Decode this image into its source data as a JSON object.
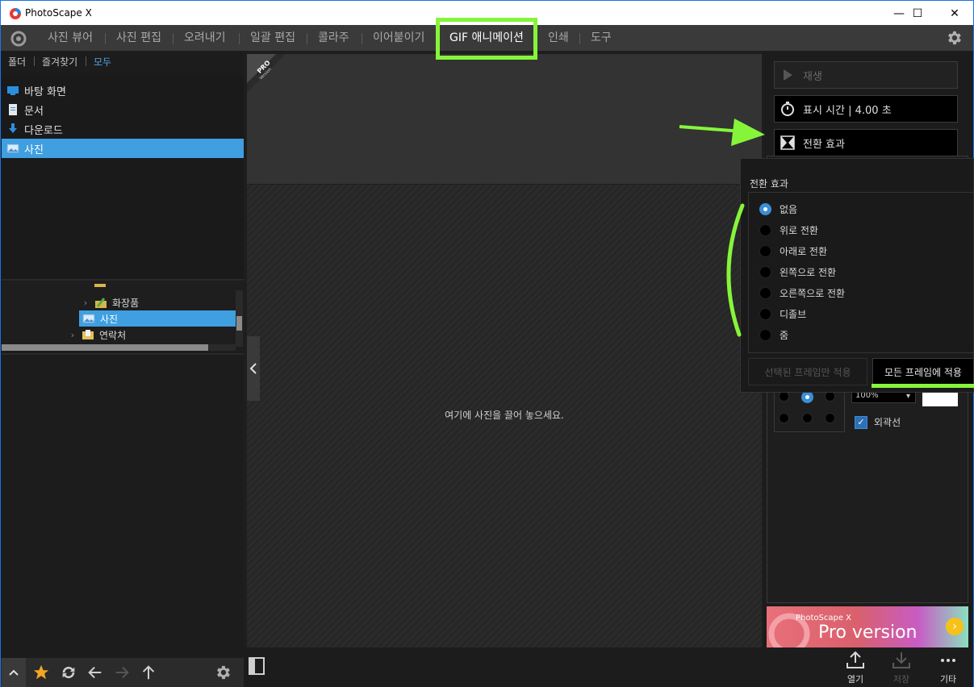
{
  "window": {
    "title": "PhotoScape X",
    "minimize": "—",
    "maximize": "☐",
    "close": "✕"
  },
  "menu": {
    "items": [
      {
        "label": "사진 뷰어"
      },
      {
        "label": "사진 편집"
      },
      {
        "label": "오려내기"
      },
      {
        "label": "일괄 편집"
      },
      {
        "label": "콜라주"
      },
      {
        "label": "이어붙이기"
      },
      {
        "label": "GIF 애니메이션"
      },
      {
        "label": "인쇄"
      },
      {
        "label": "도구"
      }
    ],
    "active": "GIF 애니메이션"
  },
  "left_panel": {
    "tabs": [
      "폴더",
      "즐겨찾기",
      "모두"
    ],
    "active_tab": "모두",
    "folders": [
      {
        "label": "바탕 화면",
        "icon": "desktop-icon"
      },
      {
        "label": "문서",
        "icon": "document-icon"
      },
      {
        "label": "다운로드",
        "icon": "download-icon"
      },
      {
        "label": "사진",
        "icon": "picture-folder-icon"
      }
    ],
    "selected_folder": "사진",
    "tree": [
      {
        "label": "화장품",
        "indent": 2
      },
      {
        "label": "사진",
        "indent": 2
      },
      {
        "label": "연락처",
        "indent": 1
      }
    ]
  },
  "center": {
    "pro_badge_top": "PRO",
    "pro_badge_bottom": "Version",
    "drop_message": "여기에 사진을 끌어 놓으세요."
  },
  "right_panel": {
    "play_label": "재생",
    "duration_label": "표시 시간 | 4.00 초",
    "transition_label": "전환 효과",
    "percent_value": "100%",
    "outline_label": "외곽선"
  },
  "popup": {
    "title": "전환 효과",
    "options": [
      "없음",
      "위로 전환",
      "아래로 전환",
      "왼쪽으로 전환",
      "오른쪽으로 전환",
      "디졸브",
      "줌"
    ],
    "selected": "없음",
    "apply_selected_label": "선택된 프레임만 적용",
    "apply_all_label": "모든 프레임에 적용"
  },
  "promo": {
    "small": "PhotoScape X",
    "big": "Pro version"
  },
  "bottom_actions": {
    "open": "열기",
    "save": "저장",
    "more": "기타"
  },
  "colors": {
    "accent": "#3f9fe0",
    "highlight": "#86f53a",
    "window_border": "#1a73e8"
  }
}
